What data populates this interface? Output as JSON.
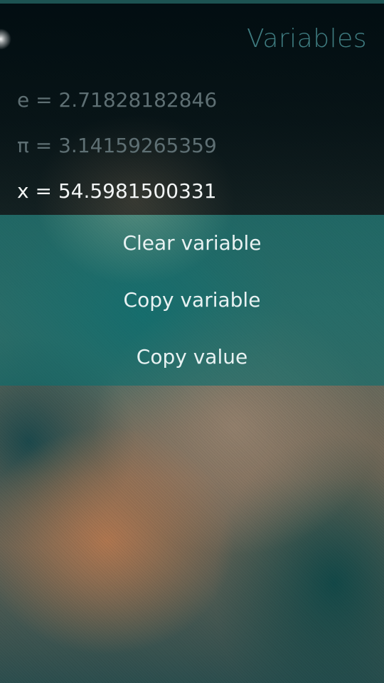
{
  "page": {
    "title": "Variables"
  },
  "variables": [
    {
      "name": "e",
      "value": "2.71828182846",
      "display": "e = 2.71828182846"
    },
    {
      "name": "π",
      "value": "3.14159265359",
      "display": "π = 3.14159265359"
    },
    {
      "name": "x",
      "value": "54.5981500331",
      "display": "x = 54.5981500331"
    }
  ],
  "context_menu": {
    "items": [
      {
        "label": "Clear variable"
      },
      {
        "label": "Copy variable"
      },
      {
        "label": "Copy value"
      }
    ]
  },
  "colors": {
    "title": "#3f7c80",
    "dimmed_text": "#5e6f73",
    "selected_text": "#f2f5f5",
    "menu_background": "#0a6e6e",
    "accent_line": "#1d5352"
  }
}
